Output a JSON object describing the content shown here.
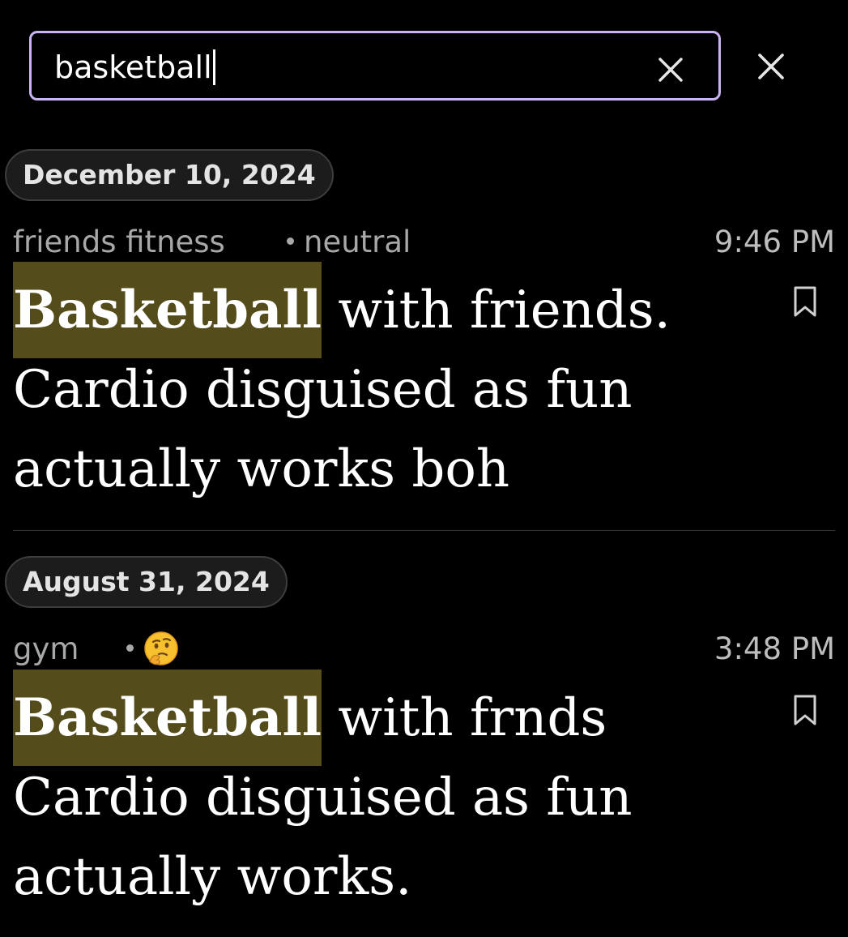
{
  "search": {
    "value": "basketball",
    "clear_icon": "clear-x-icon",
    "close_icon": "close-x-icon",
    "border_color": "#c9b3f2"
  },
  "entries": [
    {
      "date": "December 10, 2024",
      "tag": "friends fitness",
      "mood": "neutral",
      "time": "9:46 PM",
      "highlight": "Basketball",
      "rest": " with friends. Cardio disguised as fun actually works boh",
      "bookmark_icon": "bookmark-icon"
    },
    {
      "date": "August 31, 2024",
      "tag": "gym",
      "mood": "thinking-face-emoji",
      "time": "3:48 PM",
      "highlight": "Basketball",
      "rest": " with frnds Cardio disguised as fun actually works.",
      "bookmark_icon": "bookmark-icon"
    }
  ],
  "colors": {
    "background": "#000000",
    "highlight": "#544c1a",
    "pill_bg": "#1c1c1c",
    "meta_text": "#a8a8a8"
  }
}
